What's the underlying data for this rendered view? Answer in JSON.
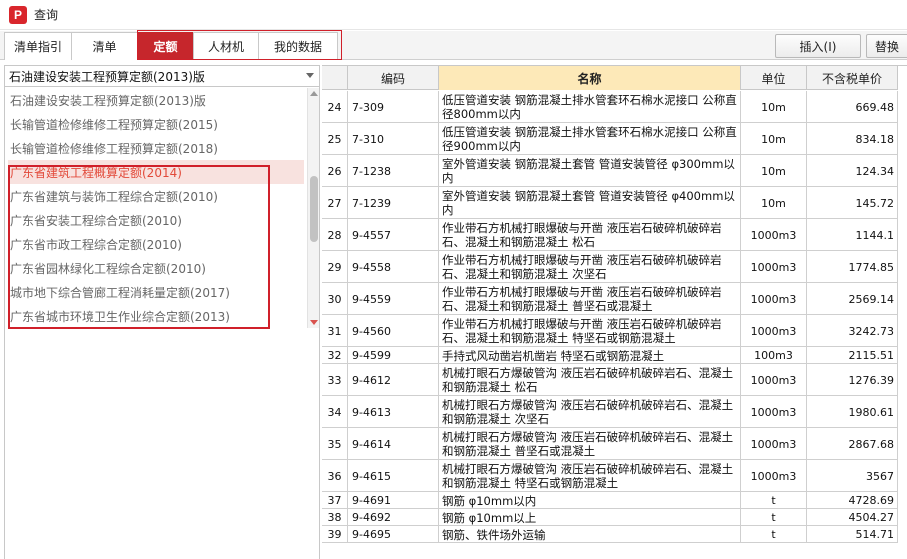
{
  "window": {
    "title": "查询",
    "icon": "app-logo-p"
  },
  "tabs": [
    {
      "label": "清单指引",
      "width": 68
    },
    {
      "label": "清单",
      "width": 67
    },
    {
      "label": "定额",
      "width": 57,
      "active": true
    },
    {
      "label": "人材机",
      "width": 66
    },
    {
      "label": "我的数据",
      "width": 80
    }
  ],
  "toolbar": {
    "insert_label": "插入(I)",
    "replace_label": "替换"
  },
  "library": {
    "selected": "石油建设安装工程预算定额(2013)版",
    "options": [
      "石油建设安装工程预算定额(2013)版",
      "长输管道检修维修工程预算定额(2015)",
      "长输管道检修维修工程预算定额(2018)",
      "广东省建筑工程概算定额(2014)",
      "广东省建筑与装饰工程综合定额(2010)",
      "广东省安装工程综合定额(2010)",
      "广东省市政工程综合定额(2010)",
      "广东省园林绿化工程综合定额(2010)",
      "城市地下综合管廊工程消耗量定额(2017)",
      "广东省城市环境卫生作业综合定额(2013)"
    ],
    "hover_index": 3
  },
  "grid": {
    "columns": {
      "index": "",
      "code": "编码",
      "name": "名称",
      "unit": "单位",
      "price": "不含税单价"
    },
    "rows": [
      {
        "index": "24",
        "code": "7-309",
        "name": "低压管道安装 钢筋混凝土排水管套环石棉水泥接口 公称直径800mm以内",
        "unit": "10m",
        "price": "669.48",
        "tall": true
      },
      {
        "index": "25",
        "code": "7-310",
        "name": "低压管道安装 钢筋混凝土排水管套环石棉水泥接口 公称直径900mm以内",
        "unit": "10m",
        "price": "834.18",
        "tall": true
      },
      {
        "index": "26",
        "code": "7-1238",
        "name": "室外管道安装 钢筋混凝土套管 管道安装管径 φ300mm以内",
        "unit": "10m",
        "price": "124.34",
        "tall": true
      },
      {
        "index": "27",
        "code": "7-1239",
        "name": "室外管道安装 钢筋混凝土套管 管道安装管径 φ400mm以内",
        "unit": "10m",
        "price": "145.72",
        "tall": true
      },
      {
        "index": "28",
        "code": "9-4557",
        "name": "作业带石方机械打眼爆破与开凿 液压岩石破碎机破碎岩石、混凝土和钢筋混凝土 松石",
        "unit": "1000m3",
        "price": "1144.1",
        "tall": true
      },
      {
        "index": "29",
        "code": "9-4558",
        "name": "作业带石方机械打眼爆破与开凿 液压岩石破碎机破碎岩石、混凝土和钢筋混凝土 次坚石",
        "unit": "1000m3",
        "price": "1774.85",
        "tall": true
      },
      {
        "index": "30",
        "code": "9-4559",
        "name": "作业带石方机械打眼爆破与开凿 液压岩石破碎机破碎岩石、混凝土和钢筋混凝土 普坚石或混凝土",
        "unit": "1000m3",
        "price": "2569.14",
        "tall": true
      },
      {
        "index": "31",
        "code": "9-4560",
        "name": "作业带石方机械打眼爆破与开凿 液压岩石破碎机破碎岩石、混凝土和钢筋混凝土 特坚石或钢筋混凝土",
        "unit": "1000m3",
        "price": "3242.73",
        "tall": true
      },
      {
        "index": "32",
        "code": "9-4599",
        "name": "手持式风动凿岩机凿岩 特坚石或钢筋混凝土",
        "unit": "100m3",
        "price": "2115.51",
        "tall": false
      },
      {
        "index": "33",
        "code": "9-4612",
        "name": "机械打眼石方爆破管沟 液压岩石破碎机破碎岩石、混凝土和钢筋混凝土 松石",
        "unit": "1000m3",
        "price": "1276.39",
        "tall": true
      },
      {
        "index": "34",
        "code": "9-4613",
        "name": "机械打眼石方爆破管沟 液压岩石破碎机破碎岩石、混凝土和钢筋混凝土 次坚石",
        "unit": "1000m3",
        "price": "1980.61",
        "tall": true
      },
      {
        "index": "35",
        "code": "9-4614",
        "name": "机械打眼石方爆破管沟 液压岩石破碎机破碎岩石、混凝土和钢筋混凝土 普坚石或混凝土",
        "unit": "1000m3",
        "price": "2867.68",
        "tall": true
      },
      {
        "index": "36",
        "code": "9-4615",
        "name": "机械打眼石方爆破管沟 液压岩石破碎机破碎岩石、混凝土和钢筋混凝土 特坚石或钢筋混凝土",
        "unit": "1000m3",
        "price": "3567",
        "tall": true
      },
      {
        "index": "37",
        "code": "9-4691",
        "name": "钢筋 φ10mm以内",
        "unit": "t",
        "price": "4728.69",
        "tall": false
      },
      {
        "index": "38",
        "code": "9-4692",
        "name": "钢筋 φ10mm以上",
        "unit": "t",
        "price": "4504.27",
        "tall": false
      },
      {
        "index": "39",
        "code": "9-4695",
        "name": "钢筋、铁件场外运输",
        "unit": "t",
        "price": "514.71",
        "tall": false
      }
    ]
  },
  "colors": {
    "accent": "#c6262c",
    "highlight_border": "#d0202a",
    "name_header": "#fde9b8",
    "hover_text": "#e24a3a"
  }
}
